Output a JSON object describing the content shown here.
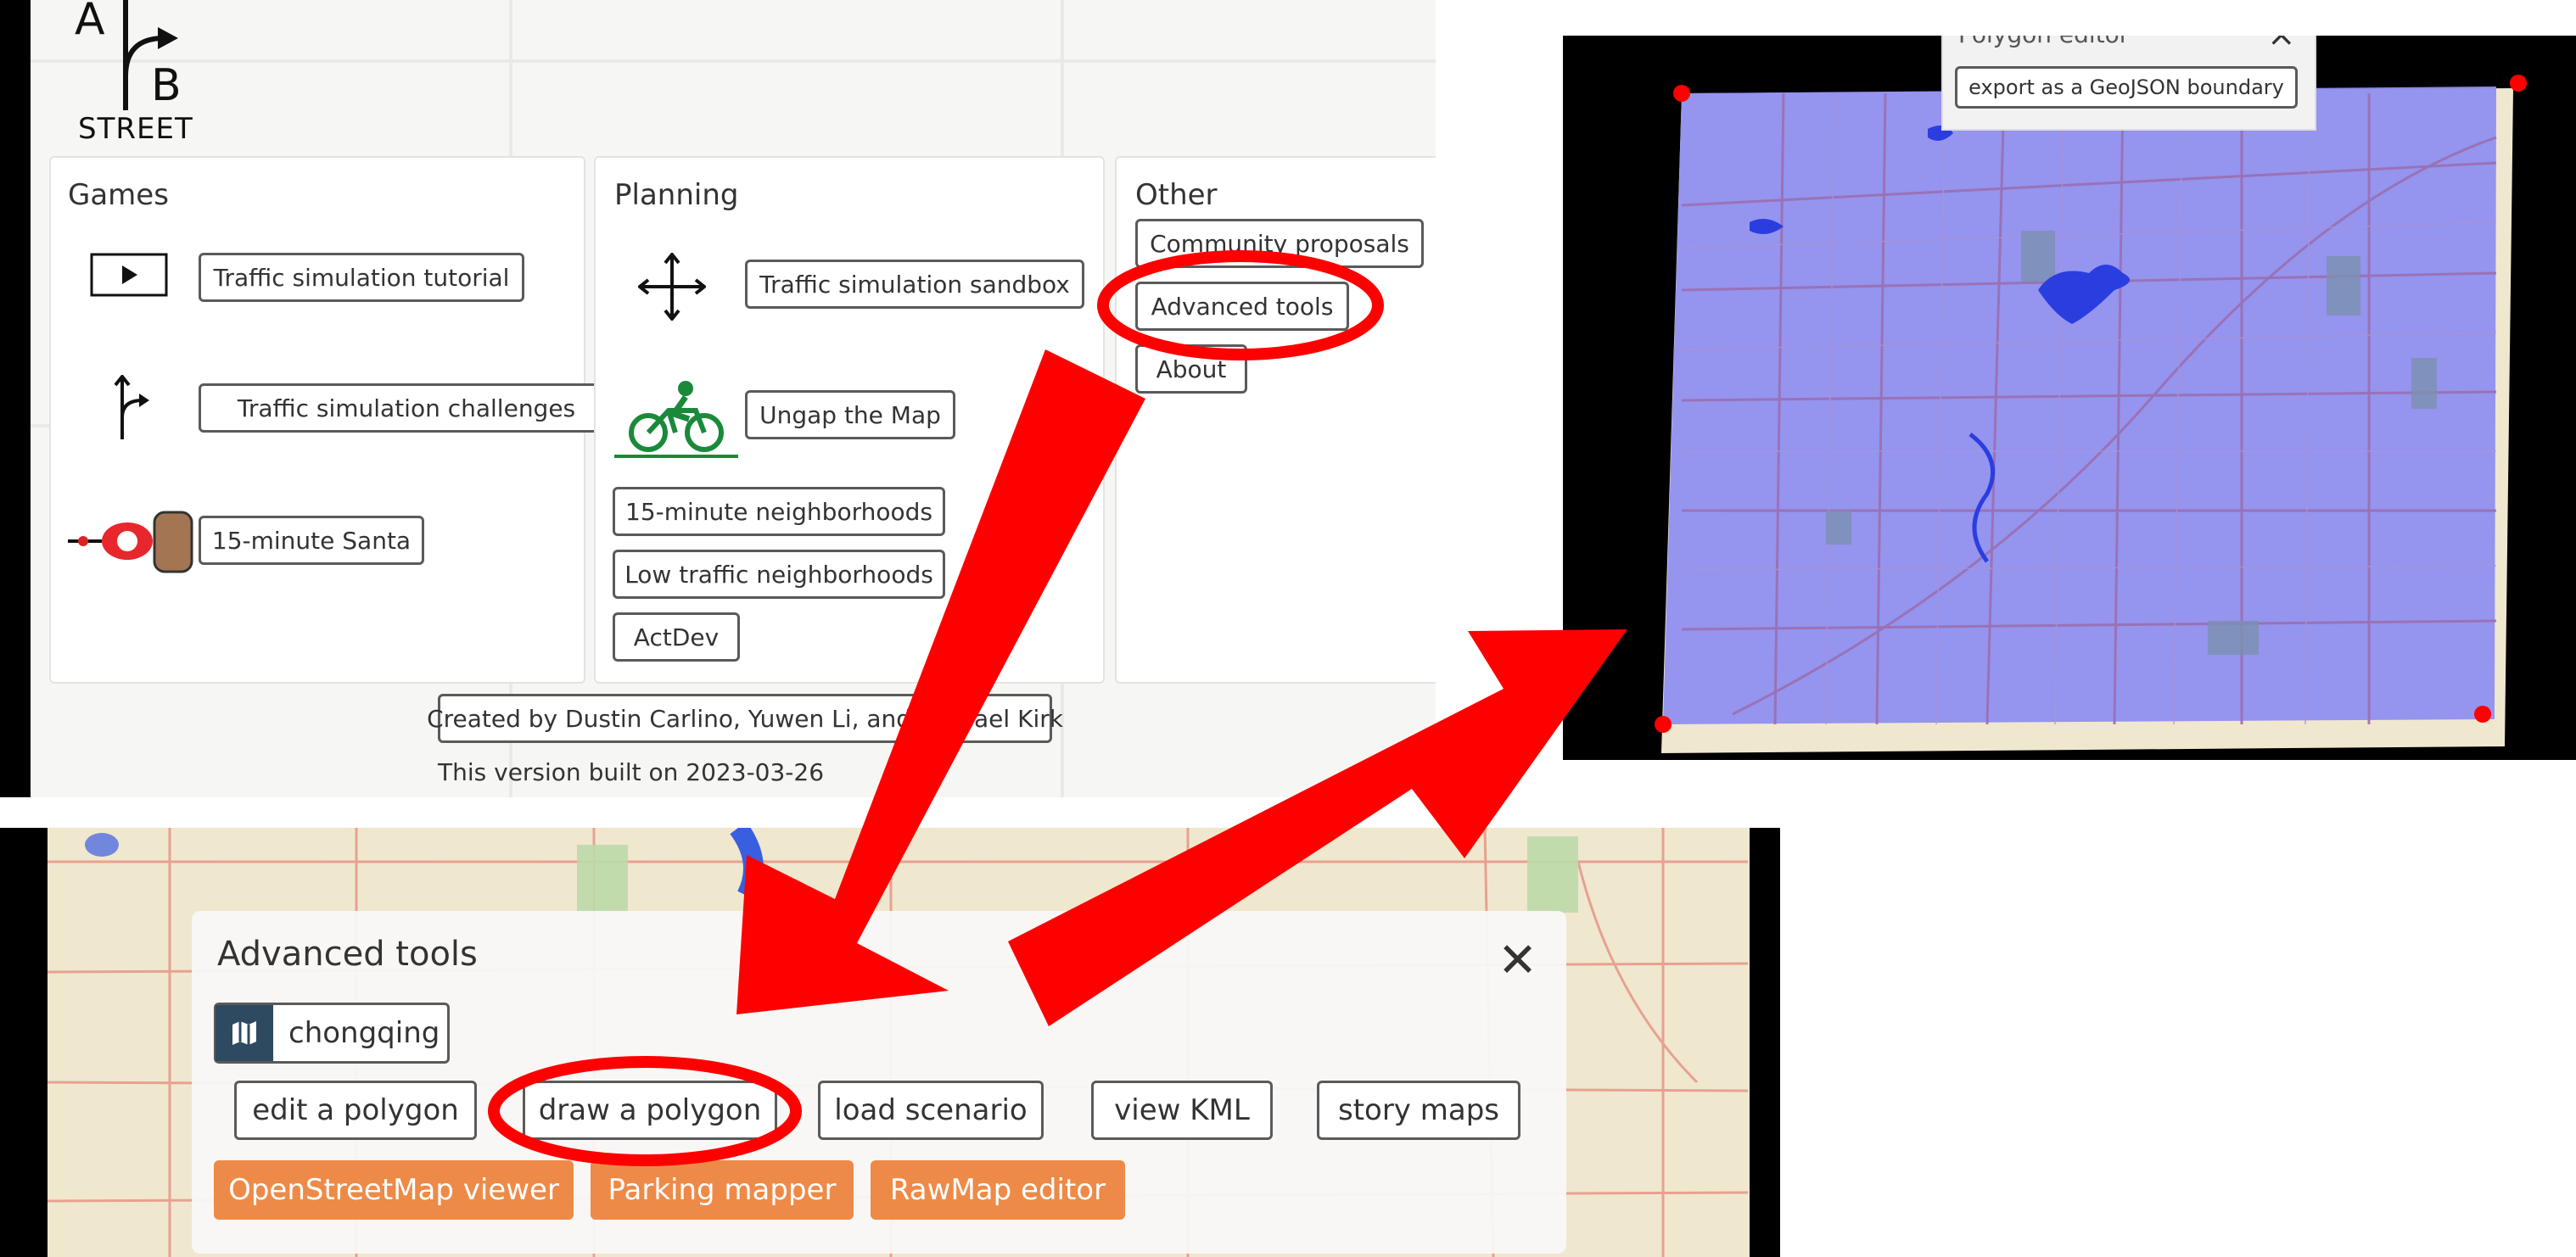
{
  "menu": {
    "logo_text": "STREET",
    "games": {
      "title": "Games",
      "buttons": [
        "Traffic simulation tutorial",
        "Traffic simulation challenges",
        "15-minute Santa"
      ]
    },
    "planning": {
      "title": "Planning",
      "buttons": [
        "Traffic simulation sandbox",
        "Ungap the Map",
        "15-minute neighborhoods",
        "Low traffic neighborhoods",
        "ActDev"
      ]
    },
    "other": {
      "title": "Other",
      "buttons": [
        "Community proposals",
        "Advanced tools",
        "About"
      ]
    },
    "credits": "Created by Dustin Carlino, Yuwen Li, and Michael Kirk",
    "build_info": "This version built on 2023-03-26"
  },
  "polygon_editor": {
    "title": "Polygon editor",
    "export_button": "export as a GeoJSON boundary"
  },
  "advanced_tools": {
    "title": "Advanced tools",
    "map_name": "chongqing",
    "row1": [
      "edit a polygon",
      "draw a polygon",
      "load scenario",
      "view KML",
      "story maps"
    ],
    "row2": [
      "OpenStreetMap viewer",
      "Parking mapper",
      "RawMap editor"
    ]
  },
  "colors": {
    "highlight_red": "#ff0000",
    "orange_button": "#ee8a47",
    "polygon_fill": "#8f8ff0",
    "map_beige": "#f0e7cf"
  }
}
